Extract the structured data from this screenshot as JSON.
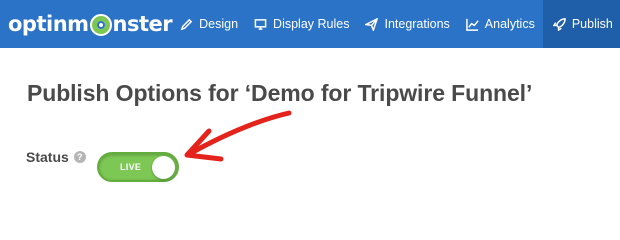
{
  "app": {
    "logo_text_pre": "optinm",
    "logo_text_post": "nster"
  },
  "nav": {
    "items": [
      {
        "label": "Design",
        "icon": "pencil-icon"
      },
      {
        "label": "Display Rules",
        "icon": "monitor-icon"
      },
      {
        "label": "Integrations",
        "icon": "paper-plane-icon"
      },
      {
        "label": "Analytics",
        "icon": "chart-icon"
      },
      {
        "label": "Publish",
        "icon": "rocket-icon",
        "active": true,
        "done": true
      }
    ]
  },
  "main": {
    "title": "Publish Options for ‘Demo for Tripwire Funnel’",
    "status_label": "Status",
    "help_symbol": "?",
    "toggle_text": "LIVE",
    "toggle_state": "on"
  },
  "colors": {
    "nav_bg": "#2b73c7",
    "nav_active_bg": "#1f5ea8",
    "toggle_on": "#7dc855",
    "annotation_arrow": "#e3231c"
  }
}
